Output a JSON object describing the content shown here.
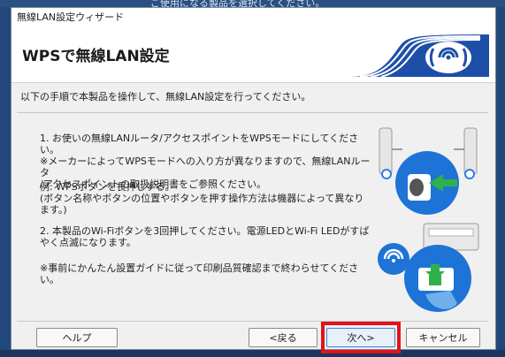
{
  "background": {
    "partial_text": "ご使用になる製品を選択してください。"
  },
  "window": {
    "title": "無線LAN設定ウィザード",
    "header_title": "WPSで無線LAN設定",
    "instruction": "以下の手順で本製品を操作して、無線LAN設定を行ってください。",
    "steps": [
      "1. お使いの無線LANルータ/アクセスポイントをWPSモードにしてください。\n※メーカーによってWPSモードへの入り方が異なりますので、無線LANルータ\n/アクセスポイントの取扱説明書をご参照ください。",
      "例: WPSボタンを長押しする。\n(ボタン名称やボタンの位置やボタンを押す操作方法は機器によって異なり\nます。)",
      "2. 本製品のWi-Fiボタンを3回押してください。電源LEDとWi-Fi LEDがすば\nやく点滅になります。",
      "※事前にかんたん設置ガイドに従って印刷品質確認まで終わらせてくださ\nい。"
    ]
  },
  "buttons": {
    "help": "ヘルプ",
    "back": "<戻る",
    "next": "次へ>",
    "cancel": "キャンセル"
  },
  "colors": {
    "highlight": "#e0141a",
    "logo_blue": "#1e4fa8",
    "arrow_green": "#2fb14a",
    "accent_blue": "#2f7fe0"
  },
  "icons": [
    "wifi-logo-icon",
    "router-wps-illustration",
    "printer-wifi-illustration"
  ]
}
